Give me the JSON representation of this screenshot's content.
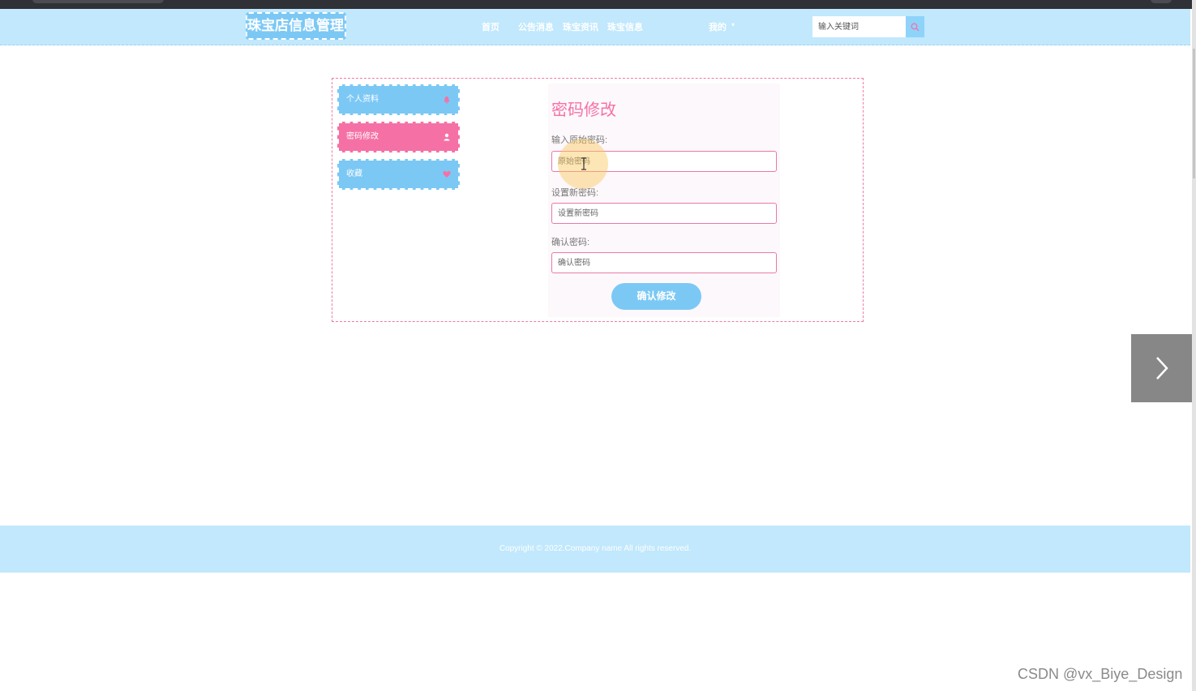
{
  "app": {
    "logo_text": "珠宝店信息管理系统"
  },
  "nav": {
    "links": [
      "首页",
      "公告消息",
      "珠宝资讯",
      "珠宝信息"
    ],
    "my_label": "我的",
    "search_placeholder": "输入关键词",
    "search_icon": "search-icon"
  },
  "sidebar": {
    "items": [
      {
        "label": "个人资料",
        "icon": "bell-icon",
        "active": false
      },
      {
        "label": "密码修改",
        "icon": "user-icon",
        "active": true
      },
      {
        "label": "收藏",
        "icon": "heart-icon",
        "active": false
      }
    ]
  },
  "form": {
    "title": "密码修改",
    "old_label": "输入原始密码:",
    "old_placeholder": "原始密码",
    "new_label": "设置新密码:",
    "new_placeholder": "设置新密码",
    "confirm_label": "确认密码:",
    "confirm_placeholder": "确认密码",
    "submit_label": "确认修改"
  },
  "footer": {
    "copyright": "Copyright © 2022.Company name All rights reserved."
  },
  "watermark": "CSDN @vx_Biye_Design",
  "colors": {
    "accent_blue": "#7cc8f5",
    "accent_pink": "#f571a5",
    "header_bg": "#c1e8fc"
  }
}
